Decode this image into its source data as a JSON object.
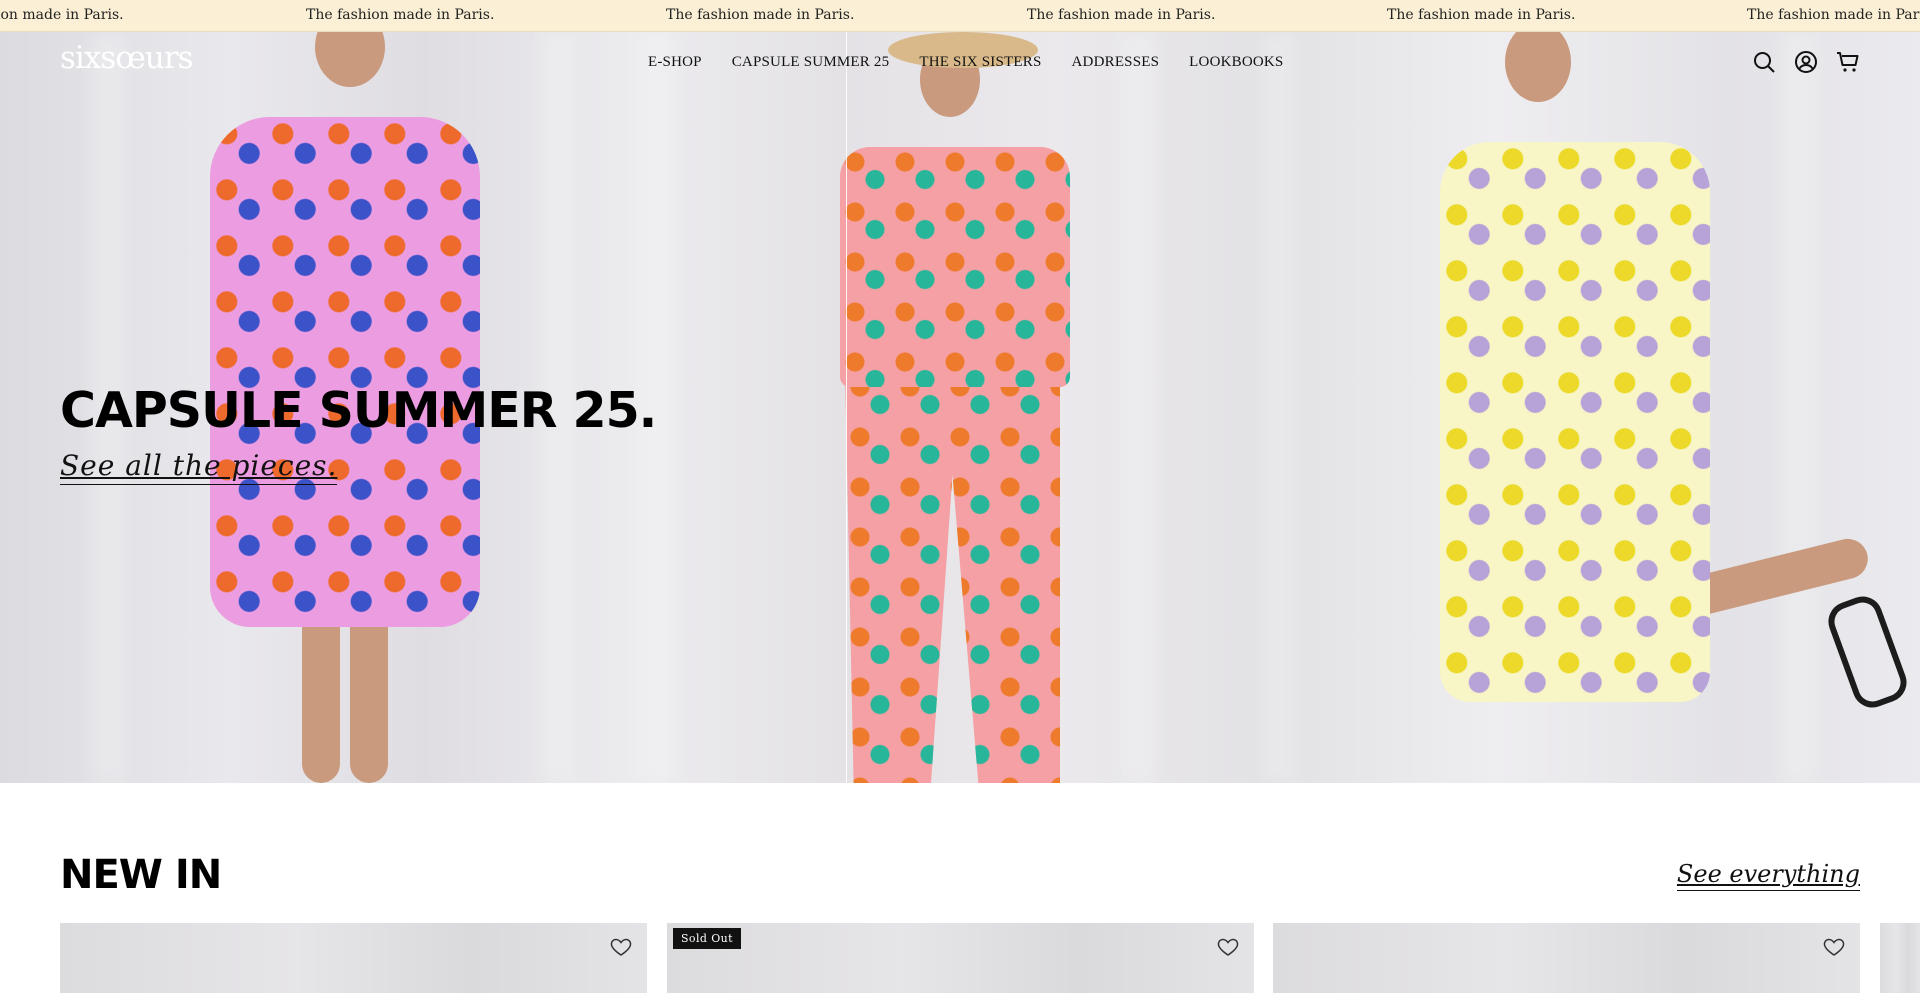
{
  "announcement": {
    "messages": [
      "ion made in Paris.",
      "The fashion made in Paris.",
      "The fashion made in Paris.",
      "The fashion made in Paris.",
      "The fashion made in Paris.",
      "The fashion made in Paris."
    ]
  },
  "header": {
    "logo": "sixsœurs",
    "nav": [
      "E-SHOP",
      "CAPSULE SUMMER 25",
      "THE SIX SISTERS",
      "ADDRESSES",
      "LOOKBOOKS"
    ],
    "icons": [
      "search-icon",
      "account-icon",
      "cart-icon"
    ]
  },
  "hero": {
    "title": "CAPSULE SUMMER 25.",
    "link": "See all the pieces."
  },
  "new_in": {
    "title": "NEW IN",
    "see_all": "See everything",
    "cards": [
      {
        "badge": ""
      },
      {
        "badge": "Sold Out"
      },
      {
        "badge": ""
      }
    ]
  },
  "colors": {
    "announcement_bg": "#fbf0d6",
    "text": "#111111",
    "badge_bg": "#111111"
  }
}
